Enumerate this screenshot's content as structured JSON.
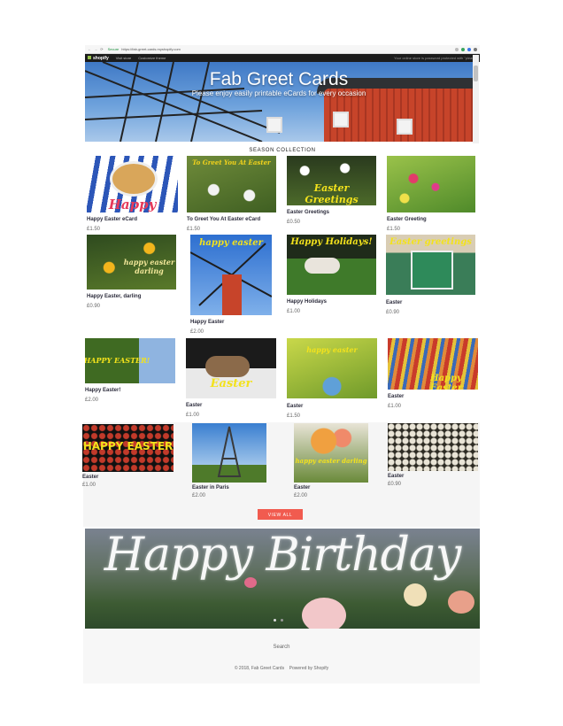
{
  "browser": {
    "secure_label": "Secure",
    "url": "https://fab-greet-cards.myshopify.com"
  },
  "shopify_bar": {
    "logo": "shopify",
    "visit_store": "Visit store",
    "customize": "Customize theme",
    "note": "Your online store is password protected with \"please\""
  },
  "hero": {
    "title": "Fab Greet Cards",
    "subtitle": "Please enjoy easily printable eCards for every occasion"
  },
  "section_title": "SEASON COLLECTION",
  "products": [
    {
      "title": "Happy Easter eCard",
      "price": "£1.50",
      "overlay": "Happy Easter"
    },
    {
      "title": "To Greet You At Easter eCard",
      "price": "£1.50",
      "overlay": "To Greet You At Easter"
    },
    {
      "title": "Easter Greetings",
      "price": "£0.50",
      "overlay": "Easter Greetings"
    },
    {
      "title": "Easter Greeting",
      "price": "£1.50",
      "overlay": ""
    },
    {
      "title": "Happy Easter, darling",
      "price": "£0.90",
      "overlay": "happy easter darling"
    },
    {
      "title": "Happy Easter",
      "price": "£2.00",
      "overlay": "happy easter"
    },
    {
      "title": "Happy Holidays",
      "price": "£1.00",
      "overlay": "Happy Holidays!"
    },
    {
      "title": "Easter",
      "price": "£0.90",
      "overlay": "Easter greetings"
    },
    {
      "title": "Happy Easter!",
      "price": "£2.00",
      "overlay": "HAPPY EASTER!"
    },
    {
      "title": "Easter",
      "price": "£1.00",
      "overlay": "Easter"
    },
    {
      "title": "Easter",
      "price": "£1.50",
      "overlay": "happy easter"
    },
    {
      "title": "Easter",
      "price": "£1.00",
      "overlay": "Happy Easter"
    },
    {
      "title": "Easter",
      "price": "£1.00",
      "overlay": "HAPPY EASTER"
    },
    {
      "title": "Easter in Paris",
      "price": "£2.00",
      "overlay": ""
    },
    {
      "title": "Easter",
      "price": "£2.00",
      "overlay": "happy easter darling"
    },
    {
      "title": "Easter",
      "price": "£0.90",
      "overlay": ""
    }
  ],
  "view_all": "VIEW ALL",
  "banner": {
    "text": "Happy Birthday"
  },
  "footer": {
    "search": "Search",
    "copyright": "© 2018, Fab Greet Cards",
    "powered": "Powered by Shopify"
  },
  "colors": {
    "accent": "#f15b4f",
    "shopify_bar": "#1c1c1c",
    "shopify_green": "#95bf47"
  }
}
